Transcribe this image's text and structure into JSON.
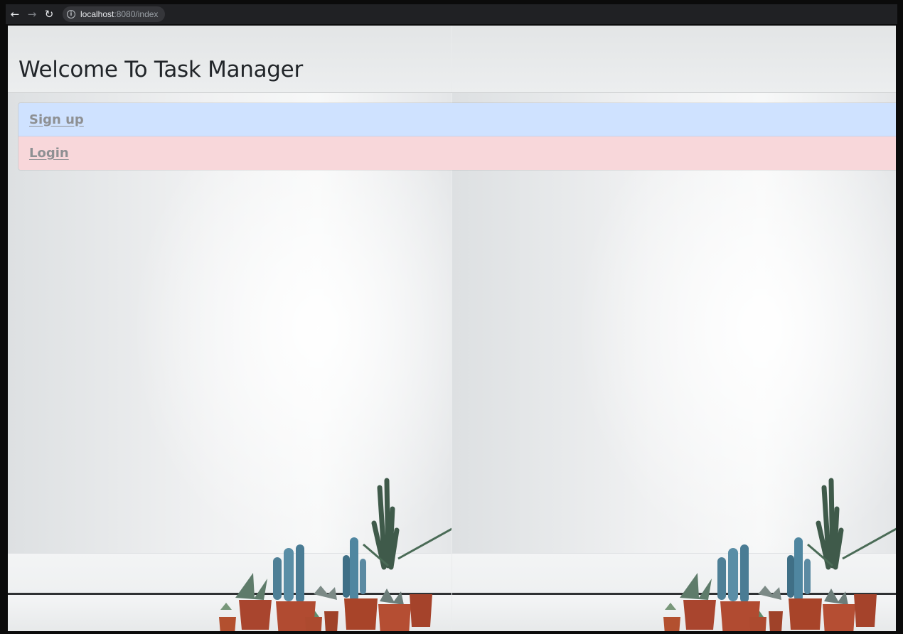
{
  "browser": {
    "back_icon": "arrow-left-icon",
    "forward_icon": "arrow-right-icon",
    "reload_icon": "reload-icon",
    "info_icon": "info-icon",
    "url_host": "localhost",
    "url_rest": ":8080/index"
  },
  "page": {
    "title": "Welcome To Task Manager",
    "links": [
      {
        "label": "Sign up",
        "style": "primary",
        "background": "#cfe2ff"
      },
      {
        "label": "Login",
        "style": "danger",
        "background": "#f8d7da"
      }
    ]
  },
  "colors": {
    "browser_bar": "#202124",
    "title_text": "#212529",
    "link_text": "#8e9093"
  }
}
